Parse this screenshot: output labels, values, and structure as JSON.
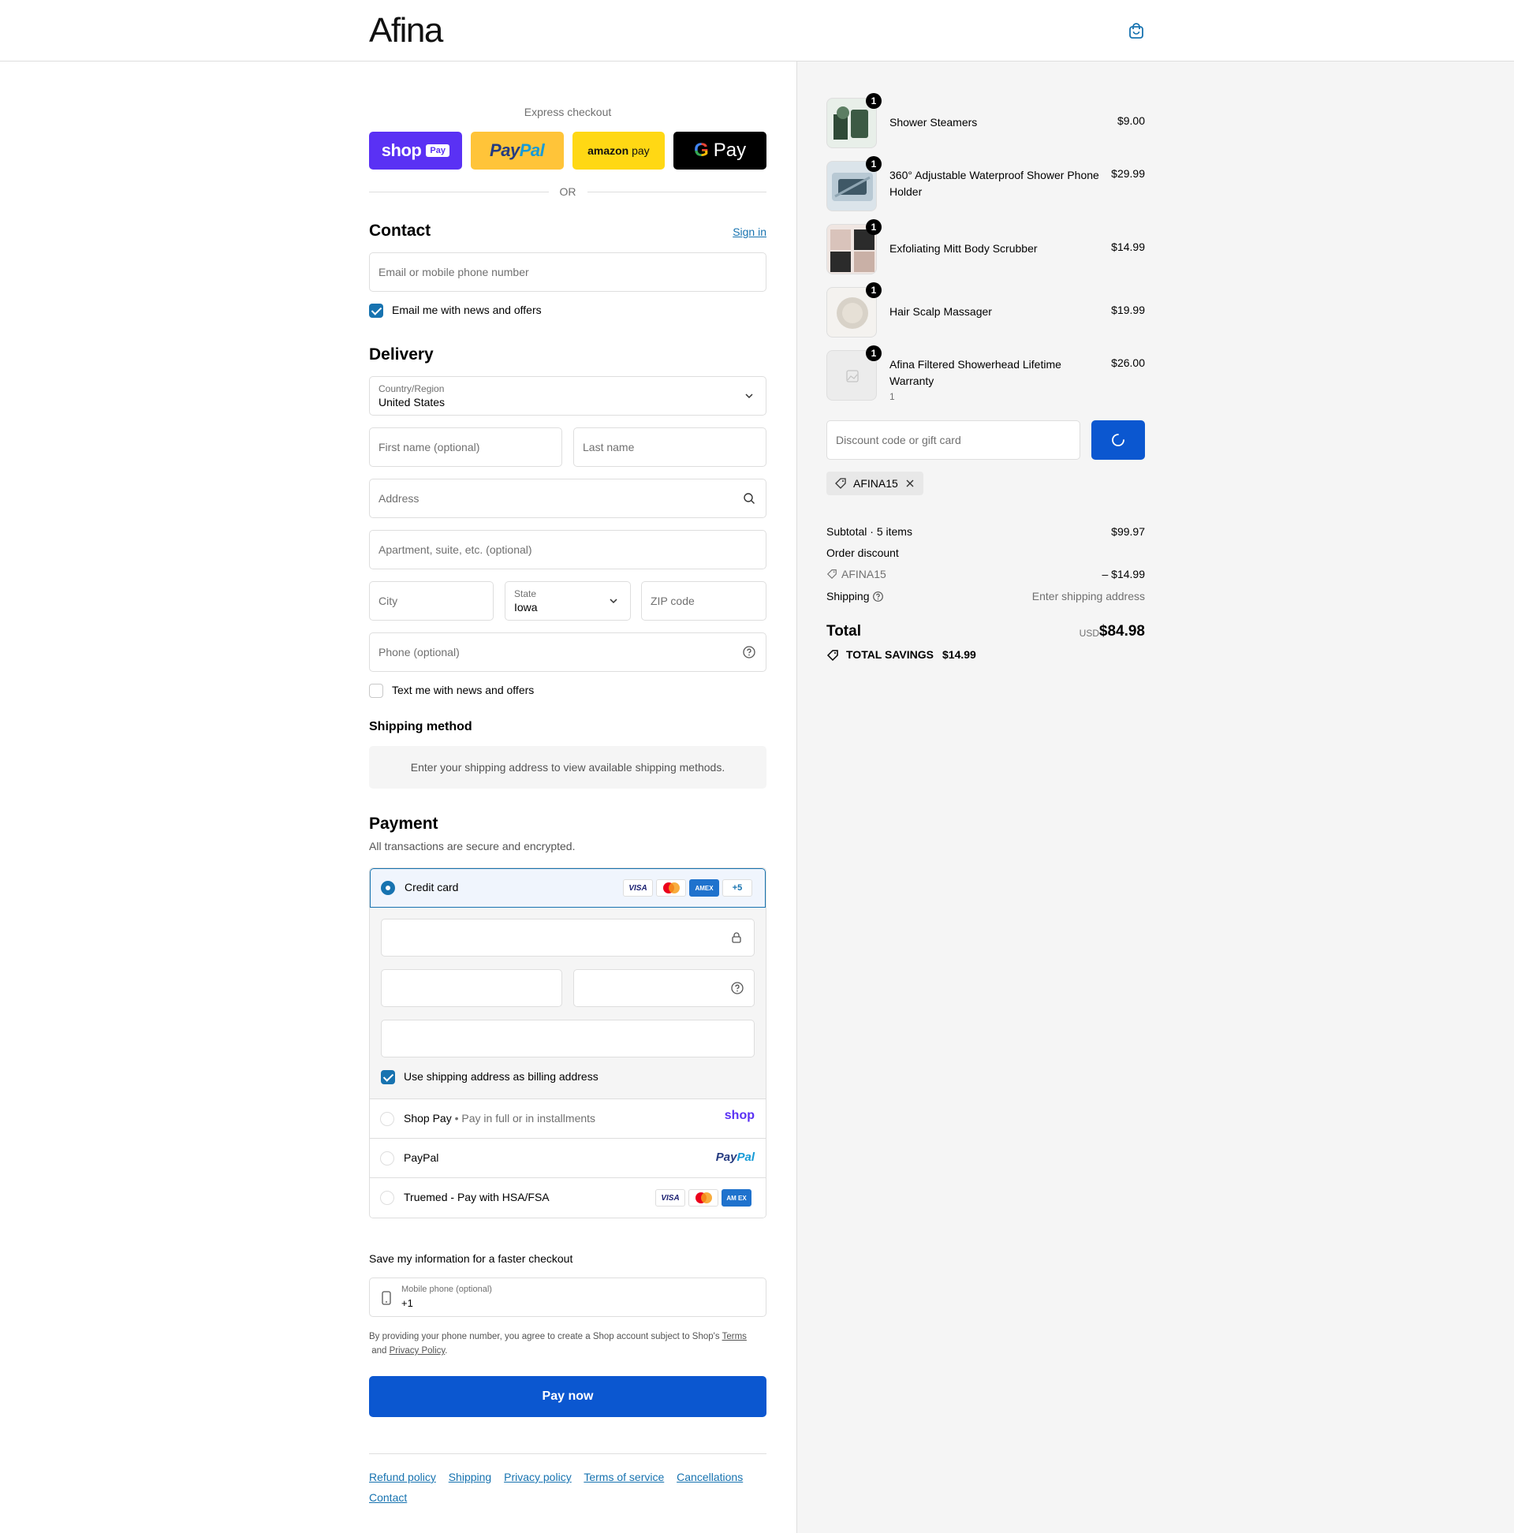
{
  "brand": {
    "logo": "Afina"
  },
  "express": {
    "title": "Express checkout",
    "shop_label": "shop",
    "shop_pay_tag": "Pay",
    "paypal_a": "Pay",
    "paypal_b": "Pal",
    "amazon_a": "amazon",
    "amazon_b": " pay",
    "gpay_g": "G",
    "gpay_label": "Pay",
    "or": "OR"
  },
  "contact": {
    "heading": "Contact",
    "sign_in": "Sign in",
    "email_placeholder": "Email or mobile phone number",
    "news_label": "Email me with news and offers",
    "news_checked": true
  },
  "delivery": {
    "heading": "Delivery",
    "country_label": "Country/Region",
    "country_value": "United States",
    "first_name_placeholder": "First name (optional)",
    "last_name_placeholder": "Last name",
    "address_placeholder": "Address",
    "apartment_placeholder": "Apartment, suite, etc. (optional)",
    "city_placeholder": "City",
    "state_label": "State",
    "state_value": "Iowa",
    "zip_placeholder": "ZIP code",
    "phone_placeholder": "Phone (optional)",
    "text_label": "Text me with news and offers",
    "text_checked": false
  },
  "shipping_method": {
    "heading": "Shipping method",
    "note": "Enter your shipping address to view available shipping methods."
  },
  "payment": {
    "heading": "Payment",
    "subtitle": "All transactions are secure and encrypted.",
    "credit_card_label": "Credit card",
    "card_visa": "VISA",
    "card_amex": "AMEX",
    "card_more": "+5",
    "billing_label": "Use shipping address as billing address",
    "billing_checked": true,
    "shop_pay_label": "Shop Pay",
    "shop_pay_sub": " • Pay in full or in installments",
    "shop_pay_logo": "shop",
    "paypal_label": "PayPal",
    "paypal_logo_a": "Pay",
    "paypal_logo_b": "Pal",
    "truemed_label": "Truemed - Pay with HSA/FSA",
    "truemed_visa": "VISA",
    "truemed_amex": "AM EX"
  },
  "save_info": {
    "heading": "Save my information for a faster checkout",
    "mobile_label": "Mobile phone (optional)",
    "mobile_value": "+1",
    "legal_a": "By providing your phone number, you agree to create a Shop account subject to Shop's ",
    "legal_terms": "Terms",
    "legal_b": " and ",
    "legal_privacy": "Privacy Policy",
    "legal_c": "."
  },
  "pay_now": "Pay now",
  "footer_links": [
    "Refund policy",
    "Shipping",
    "Privacy policy",
    "Terms of service",
    "Cancellations",
    "Contact"
  ],
  "cart": {
    "items": [
      {
        "name": "Shower Steamers",
        "price": "$9.00",
        "qty": "1"
      },
      {
        "name": "360° Adjustable Waterproof Shower Phone Holder",
        "price": "$29.99",
        "qty": "1"
      },
      {
        "name": "Exfoliating Mitt Body Scrubber",
        "price": "$14.99",
        "qty": "1"
      },
      {
        "name": "Hair Scalp Massager",
        "price": "$19.99",
        "qty": "1"
      },
      {
        "name": "Afina Filtered Showerhead Lifetime Warranty",
        "price": "$26.00",
        "qty": "1",
        "sub": "1"
      }
    ],
    "discount_placeholder": "Discount code or gift card",
    "applied_code": "AFINA15",
    "subtotal_label": "Subtotal · 5 items",
    "subtotal_value": "$99.97",
    "order_discount_label": "Order discount",
    "discount_code": "AFINA15",
    "discount_value": "– $14.99",
    "shipping_label": "Shipping",
    "shipping_value": "Enter shipping address",
    "total_label": "Total",
    "currency": "USD",
    "total_value": "$84.98",
    "savings_label": "TOTAL SAVINGS",
    "savings_value": "$14.99"
  },
  "colors": {
    "accent": "#1773b0",
    "button": "#0b57d0",
    "shop": "#5a31f4",
    "paypal": "#ffc439",
    "amazon": "#ffd814"
  }
}
